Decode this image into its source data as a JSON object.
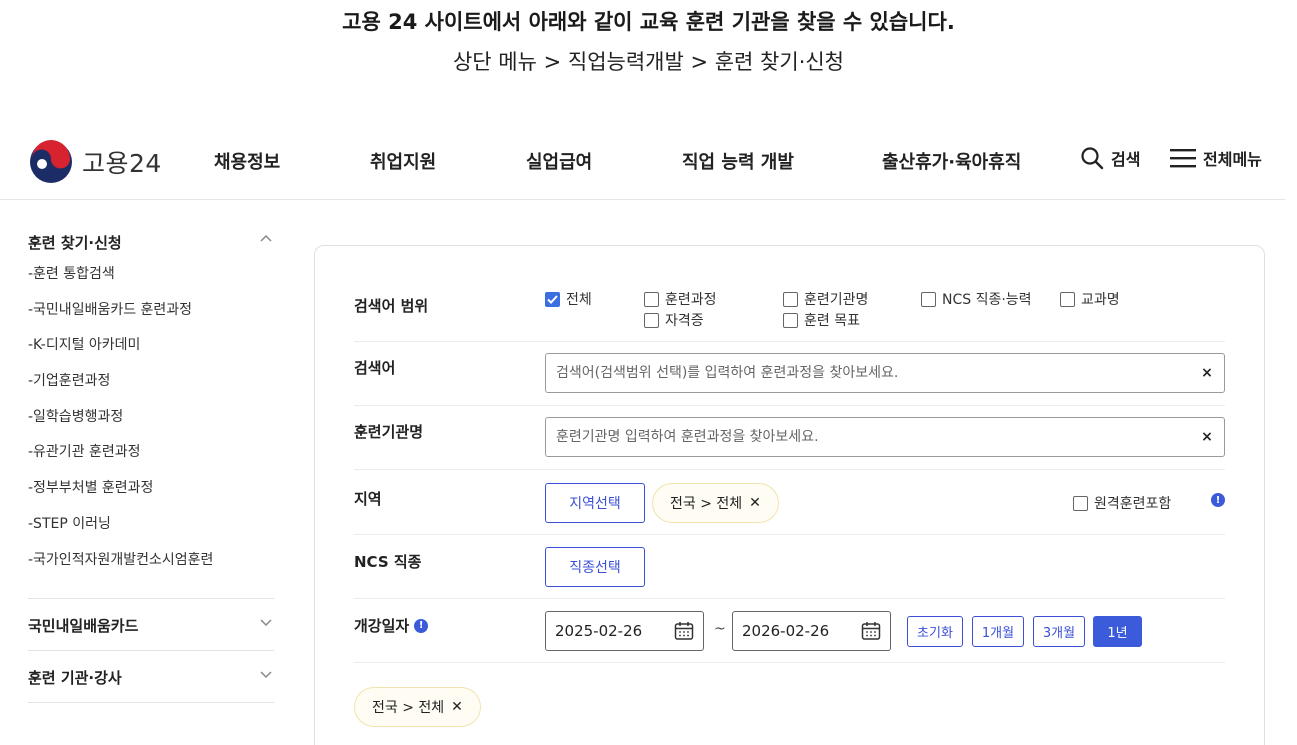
{
  "caption": {
    "line1": "고용 24 사이트에서 아래와 같이 교육 훈련 기관을 찾을 수 있습니다.",
    "line2": "상단 메뉴 > 직업능력개발 > 훈련 찾기·신청"
  },
  "header": {
    "logo_text": "고용24",
    "nav": [
      "채용정보",
      "취업지원",
      "실업급여",
      "직업 능력 개발",
      "출산휴가·육아휴직"
    ],
    "search_label": "검색",
    "menu_label": "전체메뉴"
  },
  "sidebar": {
    "section_title": "훈련 찾기·신청",
    "items": [
      "-훈련 통합검색",
      "-국민내일배움카드 훈련과정",
      "-K-디지털 아카데미",
      "-기업훈련과정",
      "-일학습병행과정",
      "-유관기관 훈련과정",
      "-정부부처별 훈련과정",
      "-STEP 이러닝",
      "-국가인적자원개발컨소시엄훈련"
    ],
    "groups": [
      "국민내일배움카드",
      "훈련 기관·강사"
    ]
  },
  "form": {
    "scope_label": "검색어 범위",
    "scope_options": [
      {
        "label": "전체",
        "checked": true
      },
      {
        "label": "훈련과정",
        "checked": false
      },
      {
        "label": "자격증",
        "checked": false
      },
      {
        "label": "훈련기관명",
        "checked": false
      },
      {
        "label": "훈련 목표",
        "checked": false
      },
      {
        "label": "NCS 직종·능력",
        "checked": false
      },
      {
        "label": "교과명",
        "checked": false
      }
    ],
    "keyword_label": "검색어",
    "keyword_placeholder": "검색어(검색범위 선택)를 입력하여 훈련과정을 찾아보세요.",
    "org_label": "훈련기관명",
    "org_placeholder": "훈련기관명 입력하여 훈련과정을 찾아보세요.",
    "clear_glyph": "×",
    "region_label": "지역",
    "region_button": "지역선택",
    "region_chip": "전국 > 전체",
    "chip_close": "✕",
    "remote_label": "원격훈련포함",
    "ncs_label": "NCS 직종",
    "ncs_button": "직종선택",
    "date_label": "개강일자",
    "info_glyph": "!",
    "date_from": "2025-02-26",
    "date_to": "2026-02-26",
    "date_sep": "~",
    "period_buttons": [
      {
        "label": "초기화",
        "active": false
      },
      {
        "label": "1개월",
        "active": false
      },
      {
        "label": "3개월",
        "active": false
      },
      {
        "label": "1년",
        "active": true
      }
    ],
    "selected_chip": "전국 > 전체"
  },
  "colors": {
    "accent": "#3b5bdb",
    "checkbox_on": "#3b6fe0",
    "chip_bg": "#fffdf3",
    "chip_border": "#f0e3b0"
  }
}
